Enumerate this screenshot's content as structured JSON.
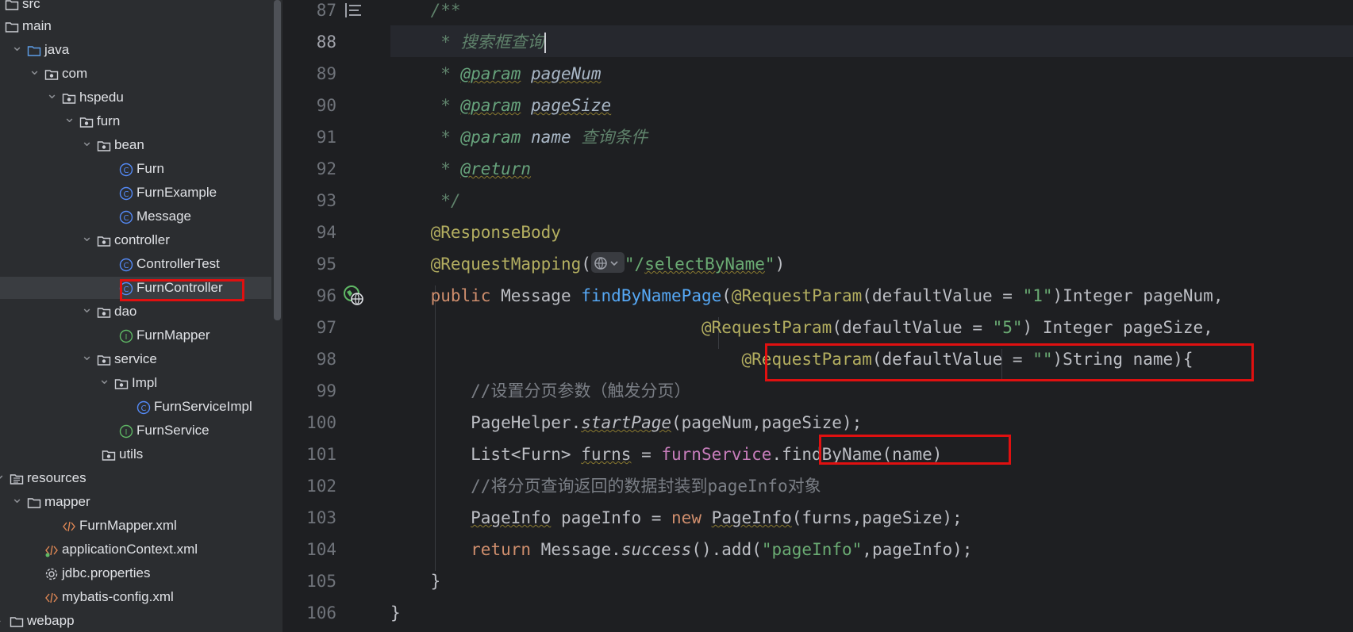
{
  "tree": {
    "items": [
      {
        "label": "src",
        "icon": "folder-icon",
        "level": 0,
        "expanded": true
      },
      {
        "label": "main",
        "icon": "folder-icon",
        "level": 0,
        "expanded": null
      },
      {
        "label": "java",
        "icon": "source-folder-icon",
        "level": 1,
        "expanded": true
      },
      {
        "label": "com",
        "icon": "package-icon",
        "level": 2,
        "expanded": true
      },
      {
        "label": "hspedu",
        "icon": "package-icon",
        "level": 3,
        "expanded": true
      },
      {
        "label": "furn",
        "icon": "package-icon",
        "level": 4,
        "expanded": true
      },
      {
        "label": "bean",
        "icon": "package-icon",
        "level": 5,
        "expanded": true
      },
      {
        "label": "Furn",
        "icon": "class-icon",
        "level": 6
      },
      {
        "label": "FurnExample",
        "icon": "class-icon",
        "level": 6
      },
      {
        "label": "Message",
        "icon": "class-icon",
        "level": 6
      },
      {
        "label": "controller",
        "icon": "package-icon",
        "level": 5,
        "expanded": true
      },
      {
        "label": "ControllerTest",
        "icon": "class-icon",
        "level": 6
      },
      {
        "label": "FurnController",
        "icon": "class-icon",
        "level": 6,
        "selected": true
      },
      {
        "label": "dao",
        "icon": "package-icon",
        "level": 5,
        "expanded": true
      },
      {
        "label": "FurnMapper",
        "icon": "interface-icon",
        "level": 6
      },
      {
        "label": "service",
        "icon": "package-icon",
        "level": 5,
        "expanded": true
      },
      {
        "label": "Impl",
        "icon": "package-icon",
        "level": 6,
        "expanded": true
      },
      {
        "label": "FurnServiceImpl",
        "icon": "class-icon",
        "level": 7
      },
      {
        "label": "FurnService",
        "icon": "interface-icon",
        "level": 6
      },
      {
        "label": "utils",
        "icon": "package-icon",
        "level": 5
      },
      {
        "label": "resources",
        "icon": "resources-folder-icon",
        "level": 0,
        "expanded": true
      },
      {
        "label": "mapper",
        "icon": "folder-icon",
        "level": 1,
        "expanded": true
      },
      {
        "label": "FurnMapper.xml",
        "icon": "xml-file-icon",
        "level": 2
      },
      {
        "label": "applicationContext.xml",
        "icon": "xml-spring-icon",
        "level": 1
      },
      {
        "label": "jdbc.properties",
        "icon": "gear-icon",
        "level": 1
      },
      {
        "label": "mybatis-config.xml",
        "icon": "xml-file-icon",
        "level": 1
      },
      {
        "label": "webapp",
        "icon": "folder-icon",
        "level": 0,
        "expanded": false
      }
    ]
  },
  "editor": {
    "current_line": "88",
    "line_numbers": [
      "87",
      "88",
      "89",
      "90",
      "91",
      "92",
      "93",
      "94",
      "95",
      "96",
      "97",
      "98",
      "99",
      "100",
      "101",
      "102",
      "103",
      "104",
      "105",
      "106"
    ],
    "lines": [
      [
        {
          "t": "    ",
          "c": ""
        },
        {
          "t": "/**",
          "c": "c-doc"
        }
      ],
      [
        {
          "t": "     ",
          "c": ""
        },
        {
          "t": "* 搜索框查询",
          "c": "c-doc"
        }
      ],
      [
        {
          "t": "     ",
          "c": ""
        },
        {
          "t": "* ",
          "c": "c-doc"
        },
        {
          "t": "@param",
          "c": "c-tag"
        },
        {
          "t": " ",
          "c": "c-doc"
        },
        {
          "t": "pageNum",
          "c": "c-param c-wavy"
        }
      ],
      [
        {
          "t": "     ",
          "c": ""
        },
        {
          "t": "* ",
          "c": "c-doc"
        },
        {
          "t": "@param",
          "c": "c-tag"
        },
        {
          "t": " ",
          "c": "c-doc"
        },
        {
          "t": "pageSize",
          "c": "c-param c-wavy"
        }
      ],
      [
        {
          "t": "     ",
          "c": ""
        },
        {
          "t": "* ",
          "c": "c-doc"
        },
        {
          "t": "@param",
          "c": "c-tag2"
        },
        {
          "t": " ",
          "c": "c-doc"
        },
        {
          "t": "name",
          "c": "c-param"
        },
        {
          "t": " 查询条件",
          "c": "c-doc"
        }
      ],
      [
        {
          "t": "     ",
          "c": ""
        },
        {
          "t": "* ",
          "c": "c-doc"
        },
        {
          "t": "@return",
          "c": "c-tag"
        }
      ],
      [
        {
          "t": "     ",
          "c": ""
        },
        {
          "t": "*/",
          "c": "c-doc"
        }
      ],
      [
        {
          "t": "    ",
          "c": ""
        },
        {
          "t": "@ResponseBody",
          "c": "c-ann"
        }
      ],
      [
        {
          "t": "    ",
          "c": ""
        },
        {
          "t": "@RequestMapping",
          "c": "c-ann"
        },
        {
          "t": "(",
          "c": ""
        },
        {
          "t": "HINT",
          "c": "hint"
        },
        {
          "t": "\"/",
          "c": "c-str"
        },
        {
          "t": "selectByName",
          "c": "c-str c-wavy"
        },
        {
          "t": "\"",
          "c": "c-str"
        },
        {
          "t": ")",
          "c": ""
        }
      ],
      [
        {
          "t": "    ",
          "c": ""
        },
        {
          "t": "public ",
          "c": "c-kw"
        },
        {
          "t": "Message ",
          "c": ""
        },
        {
          "t": "findByNamePage",
          "c": "c-fn"
        },
        {
          "t": "(",
          "c": ""
        },
        {
          "t": "@RequestParam",
          "c": "c-ann"
        },
        {
          "t": "(defaultValue = ",
          "c": ""
        },
        {
          "t": "\"1\"",
          "c": "c-str"
        },
        {
          "t": ")Integer pageNum,",
          "c": ""
        }
      ],
      [
        {
          "t": "                               ",
          "c": ""
        },
        {
          "t": "@RequestParam",
          "c": "c-ann"
        },
        {
          "t": "(defaultValue = ",
          "c": ""
        },
        {
          "t": "\"5\"",
          "c": "c-str"
        },
        {
          "t": ") Integer pageSize,",
          "c": ""
        }
      ],
      [
        {
          "t": "                                   ",
          "c": ""
        },
        {
          "t": "@RequestParam",
          "c": "c-ann"
        },
        {
          "t": "(defaultValue = ",
          "c": ""
        },
        {
          "t": "\"\"",
          "c": "c-str"
        },
        {
          "t": ")String name){",
          "c": ""
        }
      ],
      [
        {
          "t": "        ",
          "c": ""
        },
        {
          "t": "//设置分页参数（触发分页）",
          "c": "c-com"
        }
      ],
      [
        {
          "t": "        PageHelper.",
          "c": ""
        },
        {
          "t": "startPage",
          "c": "c-ital c-wavy"
        },
        {
          "t": "(pageNum,pageSize);",
          "c": ""
        }
      ],
      [
        {
          "t": "        List<Furn> ",
          "c": ""
        },
        {
          "t": "furns",
          "c": "c-wavy"
        },
        {
          "t": " = ",
          "c": ""
        },
        {
          "t": "furnService",
          "c": "c-field"
        },
        {
          "t": ".findByName(name)",
          "c": ""
        }
      ],
      [
        {
          "t": "        ",
          "c": ""
        },
        {
          "t": "//将分页查询返回的数据封装到pageInfo对象",
          "c": "c-com"
        }
      ],
      [
        {
          "t": "        ",
          "c": ""
        },
        {
          "t": "PageInfo",
          "c": "c-wavy"
        },
        {
          "t": " pageInfo = ",
          "c": ""
        },
        {
          "t": "new ",
          "c": "c-kw"
        },
        {
          "t": "PageInfo",
          "c": "c-wavy"
        },
        {
          "t": "(furns,pageSize);",
          "c": ""
        }
      ],
      [
        {
          "t": "        ",
          "c": ""
        },
        {
          "t": "return ",
          "c": "c-kw"
        },
        {
          "t": "Message.",
          "c": ""
        },
        {
          "t": "success",
          "c": "c-ital"
        },
        {
          "t": "().add(",
          "c": ""
        },
        {
          "t": "\"pageInfo\"",
          "c": "c-str"
        },
        {
          "t": ",pageInfo);",
          "c": ""
        }
      ],
      [
        {
          "t": "    }",
          "c": ""
        }
      ],
      [
        {
          "t": "}",
          "c": ""
        }
      ]
    ]
  },
  "colors": {
    "highlight_box": "#e01010",
    "annotation": "#b3ae60",
    "string": "#6aab73",
    "keyword": "#cf8e6d",
    "method": "#56a8f5"
  }
}
